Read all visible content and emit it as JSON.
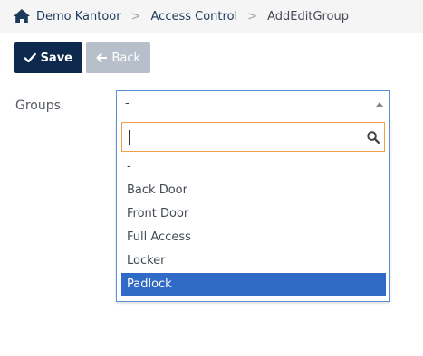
{
  "breadcrumb": {
    "items": [
      "Demo Kantoor",
      "Access Control",
      "AddEditGroup"
    ],
    "separator": ">"
  },
  "toolbar": {
    "save_label": "Save",
    "back_label": "Back"
  },
  "form": {
    "groups_label": "Groups",
    "groups_value": "-",
    "search_value": "",
    "options": [
      "-",
      "Back Door",
      "Front Door",
      "Full Access",
      "Locker",
      "Padlock"
    ],
    "highlighted_option": "Padlock"
  },
  "colors": {
    "primary_button": "#0d2a4e",
    "disabled_button": "#b7c0ca",
    "highlight": "#2f6ac6",
    "search_border": "#f0a04b",
    "dropdown_border": "#5b8fd6"
  }
}
